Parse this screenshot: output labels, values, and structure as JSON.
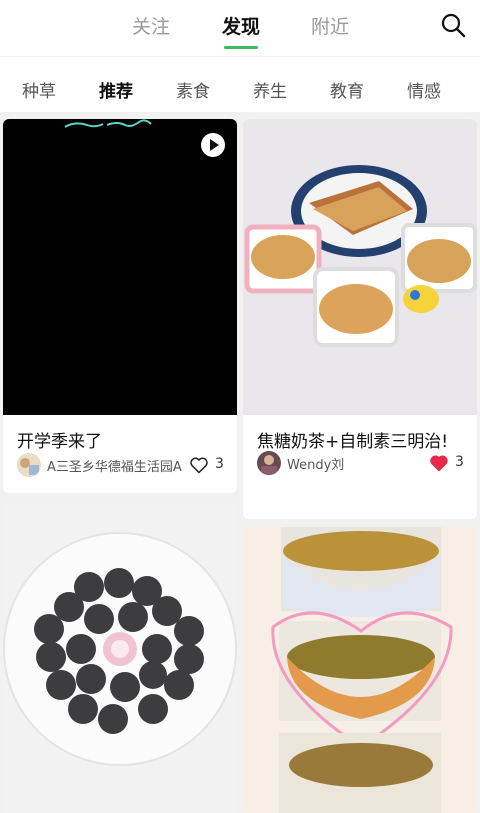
{
  "top_tabs": [
    "关注",
    "发现",
    "附近"
  ],
  "active_top_tab": "发现",
  "categories": [
    "种草",
    "推荐",
    "素食",
    "养生",
    "教育",
    "情感"
  ],
  "active_category": "推荐",
  "cards": [
    {
      "title": "开学季来了",
      "author": "A三圣乡华德福生活园A",
      "likes": "3",
      "liked": false,
      "is_video": true
    },
    {
      "title": "焦糖奶茶+自制素三明治!",
      "author": "Wendy刘",
      "likes": "3",
      "liked": true,
      "is_video": false
    },
    {
      "title": "",
      "author": "",
      "likes": "",
      "liked": false,
      "is_video": false
    },
    {
      "title": "",
      "author": "",
      "likes": "",
      "liked": false,
      "is_video": false
    }
  ],
  "colors": {
    "accent": "#3cbb63",
    "liked": "#e8294a"
  },
  "icons": {
    "search": "search-icon",
    "heart": "heart-icon",
    "play": "play-icon"
  }
}
